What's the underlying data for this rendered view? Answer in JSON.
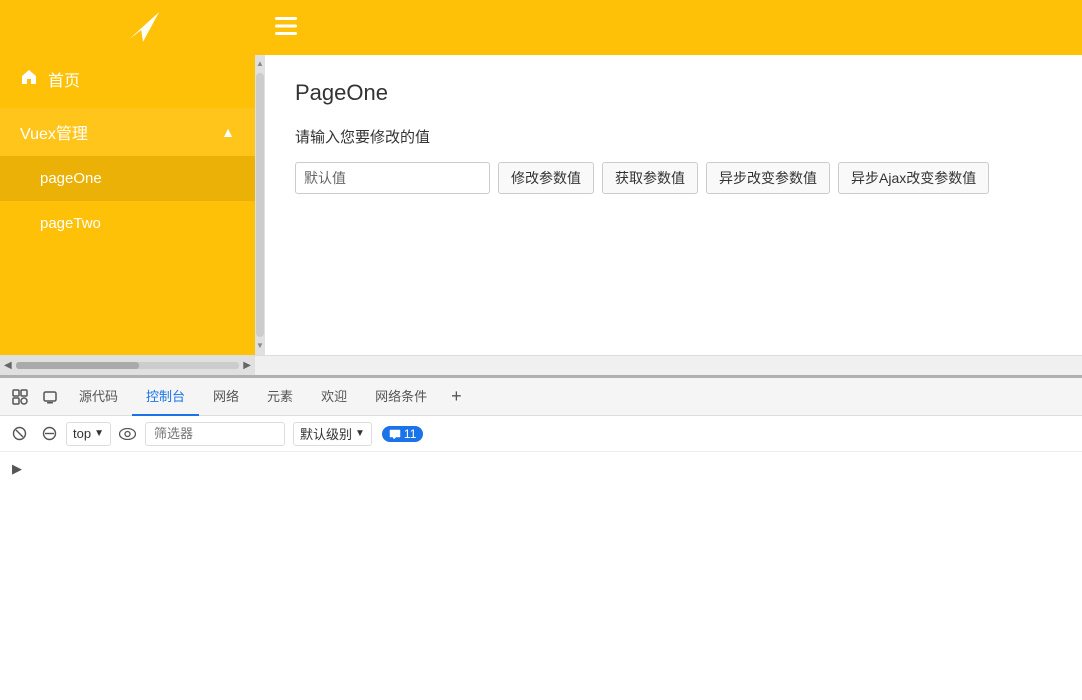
{
  "app": {
    "title": "PageOne"
  },
  "header": {
    "hamburger_label": "☰"
  },
  "sidebar": {
    "home_label": "首页",
    "vuex_label": "Vuex管理",
    "items": [
      {
        "label": "pageOne",
        "active": true
      },
      {
        "label": "pageTwo",
        "active": false
      }
    ]
  },
  "content": {
    "page_title": "PageOne",
    "input_label": "请输入您要修改的值",
    "input_placeholder": "默认值",
    "buttons": [
      {
        "label": "修改参数值"
      },
      {
        "label": "获取参数值"
      },
      {
        "label": "异步改变参数值"
      },
      {
        "label": "异步Ajax改变参数值"
      }
    ]
  },
  "devtools": {
    "tabs": [
      {
        "label": "源代码",
        "active": false
      },
      {
        "label": "控制台",
        "active": true
      },
      {
        "label": "网络",
        "active": false
      },
      {
        "label": "元素",
        "active": false
      },
      {
        "label": "欢迎",
        "active": false
      },
      {
        "label": "网络条件",
        "active": false
      }
    ],
    "console_toolbar": {
      "top_label": "top",
      "filter_placeholder": "筛选器",
      "level_label": "默认级别",
      "message_count": "11"
    }
  }
}
